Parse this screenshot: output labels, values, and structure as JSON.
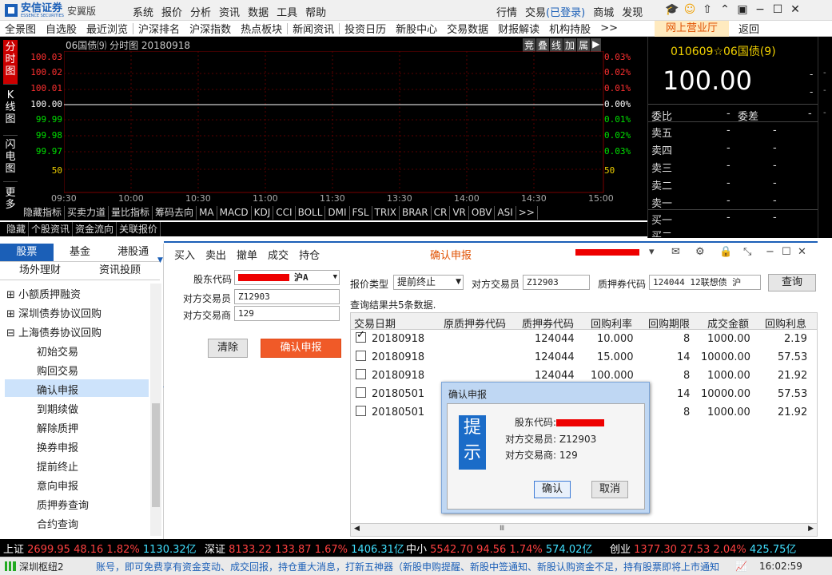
{
  "app": {
    "name": "安信证券",
    "name_en": "ESSENCE SECURITIES",
    "edition": "安翼版"
  },
  "menu": [
    "系统",
    "报价",
    "分析",
    "资讯",
    "数据",
    "工具",
    "帮助"
  ],
  "top_right": {
    "quote": "行情",
    "trade": "交易",
    "login": "(已登录)",
    "mall": "商城",
    "discover": "发现"
  },
  "nav": [
    "全景图",
    "自选股",
    "最近浏览",
    "沪深排名",
    "沪深指数",
    "热点板块",
    "新闻资讯",
    "投资日历",
    "新股中心",
    "交易数据",
    "财报解读",
    "机构持股",
    ">>"
  ],
  "nav_hall": "网上营业厅",
  "nav_back": "返回",
  "chart": {
    "title": "06国债⑼ 分时图 20180918",
    "tools": [
      "竞",
      "叠",
      "线",
      "加",
      "属",
      "▶"
    ],
    "left_vtabs": [
      "分时图",
      "K线图",
      "闪电图",
      "更多"
    ],
    "yleft": [
      "100.03",
      "100.02",
      "100.01",
      "100.00",
      "99.99",
      "99.98",
      "99.97",
      "50"
    ],
    "yright": [
      "0.03%",
      "0.02%",
      "0.01%",
      "0.00%",
      "0.01%",
      "0.02%",
      "0.03%",
      "50"
    ],
    "xticks": [
      "09:30",
      "10:00",
      "10:30",
      "11:00",
      "11:30",
      "13:30",
      "14:00",
      "14:30",
      "15:00"
    ],
    "indicators": [
      "隐藏指标",
      "买卖力道",
      "量比指标",
      "筹码去向",
      "MA",
      "MACD",
      "KDJ",
      "CCI",
      "BOLL",
      "DMI",
      "FSL",
      "TRIX",
      "BRAR",
      "CR",
      "VR",
      "OBV",
      "ASI",
      ">>"
    ],
    "info_tabs": [
      "隐藏",
      "个股资讯",
      "资金流向",
      "关联报价"
    ]
  },
  "quote_panel": {
    "code": "010609",
    "star": "☆",
    "name": "06国债(9)",
    "price": "100.00",
    "wb": "委比",
    "wb_val": "-",
    "wc": "委差",
    "wc_val": "-",
    "dash": "-",
    "levels": [
      "卖五",
      "卖四",
      "卖三",
      "卖二",
      "卖一",
      "买一",
      "买二"
    ]
  },
  "left_tabs": {
    "stock": "股票",
    "fund": "基金",
    "hk": "港股通",
    "otc": "场外理财",
    "invest": "资讯投顾"
  },
  "tree": {
    "groups": [
      "小额质押融资",
      "深圳债券协议回购",
      "上海债券协议回购"
    ],
    "items": [
      "初始交易",
      "购回交易",
      "确认申报",
      "到期续做",
      "解除质押",
      "换券申报",
      "提前终止",
      "意向申报",
      "质押券查询",
      "合约查询"
    ]
  },
  "toolbar": [
    "买入",
    "卖出",
    "撤单",
    "成交",
    "持仓"
  ],
  "panel_title": "确认申报",
  "form": {
    "holder_label": "股东代码",
    "market": "沪A",
    "trader_label": "对方交易员",
    "trader_val": "Z12903",
    "firm_label": "对方交易商",
    "firm_val": "129",
    "clear": "清除",
    "confirm": "确认申报"
  },
  "query": {
    "type_label": "报价类型",
    "type_val": "提前终止",
    "trader_label": "对方交易员",
    "trader_val": "Z12903",
    "pledge_label": "质押券代码",
    "pledge_val": "124044 12联想债 沪",
    "btn": "查询",
    "result": "查询结果共5条数据."
  },
  "grid": {
    "headers": [
      "交易日期",
      "原质押券代码",
      "质押券代码",
      "回购利率",
      "回购期限",
      "成交金额",
      "回购利息"
    ],
    "rows": [
      {
        "checked": true,
        "date": "20180918",
        "orig": "",
        "code": "124044",
        "rate": "10.000",
        "term": "8",
        "amt": "1000.00",
        "int": "2.19"
      },
      {
        "checked": false,
        "date": "20180918",
        "orig": "",
        "code": "124044",
        "rate": "15.000",
        "term": "14",
        "amt": "10000.00",
        "int": "57.53"
      },
      {
        "checked": false,
        "date": "20180918",
        "orig": "",
        "code": "124044",
        "rate": "100.000",
        "term": "8",
        "amt": "1000.00",
        "int": "21.92"
      },
      {
        "checked": false,
        "date": "20180501",
        "orig": "",
        "code": "",
        "rate": "",
        "term": "14",
        "amt": "10000.00",
        "int": "57.53"
      },
      {
        "checked": false,
        "date": "20180501",
        "orig": "",
        "code": "",
        "rate": "",
        "term": "8",
        "amt": "1000.00",
        "int": "21.92"
      }
    ]
  },
  "dialog": {
    "title": "确认申报",
    "tip": "提示",
    "holder": "股东代码:",
    "trader": "对方交易员: Z12903",
    "firm": "对方交易商: 129",
    "ok": "确认",
    "cancel": "取消"
  },
  "status": [
    {
      "n": "上证",
      "p": "2699.95",
      "c": "48.16",
      "pc": "1.82%",
      "v": "1130.32亿"
    },
    {
      "n": "深证",
      "p": "8133.22",
      "c": "133.87",
      "pc": "1.67%",
      "v": "1406.31亿"
    },
    {
      "n": "中小",
      "p": "5542.70",
      "c": "94.56",
      "pc": "1.74%",
      "v": "574.02亿"
    },
    {
      "n": "创业",
      "p": "1377.30",
      "c": "27.53",
      "pc": "2.04%",
      "v": "425.75亿"
    }
  ],
  "footer": {
    "server": "深圳枢纽2",
    "msg": "账号，即可免费享有资金变动、成交回报，持仓重大消息，打新五神器（新股申购提醒、新股中签通知、新股认购资金不足，持有股票即将上市通知",
    "time": "16:02:59"
  }
}
